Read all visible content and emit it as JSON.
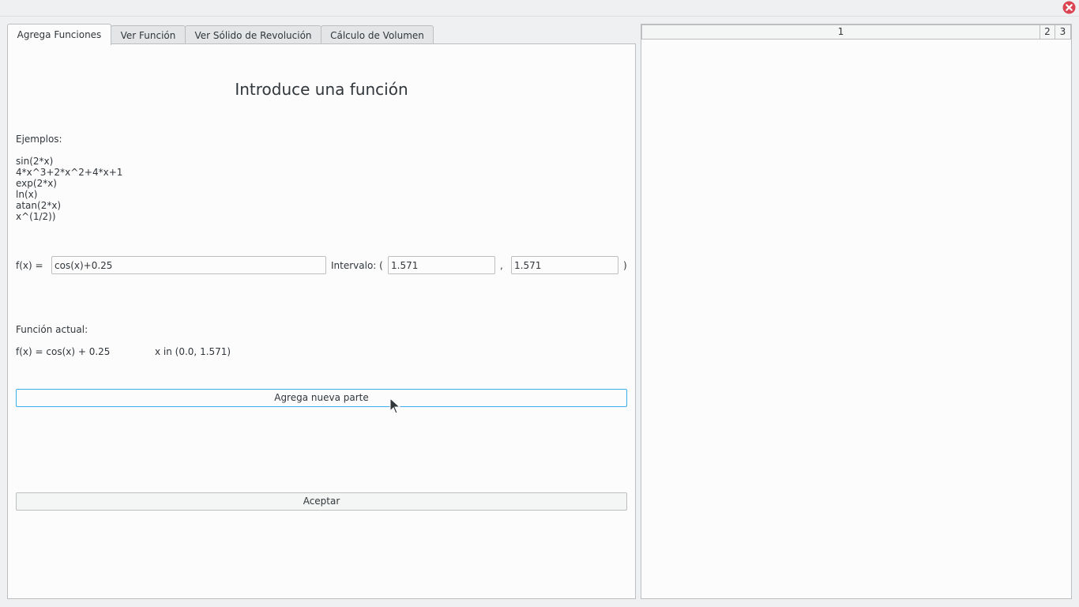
{
  "tabs": [
    {
      "label": "Agrega Funciones"
    },
    {
      "label": "Ver Función"
    },
    {
      "label": "Ver Sólido de Revolución"
    },
    {
      "label": "Cálculo de Volumen"
    }
  ],
  "main": {
    "heading": "Introduce una función",
    "examples_title": "Ejemplos:",
    "examples": [
      "sin(2*x)",
      "4*x^3+2*x^2+4*x+1",
      "exp(2*x)",
      "ln(x)",
      "atan(2*x)",
      "x^(1/2))"
    ],
    "fx_label": "f(x) =",
    "fx_value": "cos(x)+0.25",
    "interval_label": "Intervalo: (",
    "interval_start": "1.571",
    "comma": ",",
    "interval_end": "1.571",
    "close_paren": ")",
    "current_title": "Función actual:",
    "current_function": "f(x) = cos(x) + 0.25",
    "current_interval": "x in (0.0, 1.571)",
    "add_part_button": "Agrega nueva parte",
    "accept_button": "Aceptar"
  },
  "right_panel": {
    "tabs": [
      "1",
      "2",
      "3"
    ]
  },
  "icons": {
    "close": "close-icon"
  },
  "colors": {
    "accent": "#3daee9",
    "close": "#da4453"
  }
}
